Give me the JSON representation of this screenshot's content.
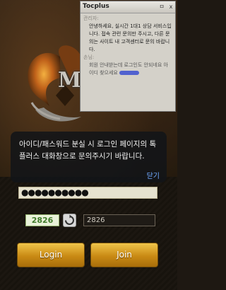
{
  "chat": {
    "title": "Tocplus",
    "minimize_label": "ㅁ",
    "close_label": "x",
    "messages": [
      {
        "sender": "관리자:",
        "text": "안녕하세요, 실시간 1대1 상담 서비스입니다. 접속 관련 문의만 주시고, 다른 문의는 사이트 내 고객센터로 문의 바랍니다."
      },
      {
        "sender": "손님:",
        "text": "회원 안내받는데 로그인도 안되네요 아이디 찾으세요"
      }
    ]
  },
  "logo": {
    "letter": "M"
  },
  "toast": {
    "message": "아이디/패스워드 분실 시 로그인 페이지의 톡플러스 대화창으로 문의주시기 바랍니다.",
    "close_label": "닫기"
  },
  "login_form": {
    "password_value": "●●●●●●●●●●",
    "captcha_code": "2826",
    "captcha_input_value": "2826"
  },
  "buttons": {
    "login": "Login",
    "join": "Join"
  },
  "colors": {
    "button_gold": "#e0a82c",
    "captcha_green": "#3f7a2a",
    "toast_link": "#6fa8ff"
  }
}
